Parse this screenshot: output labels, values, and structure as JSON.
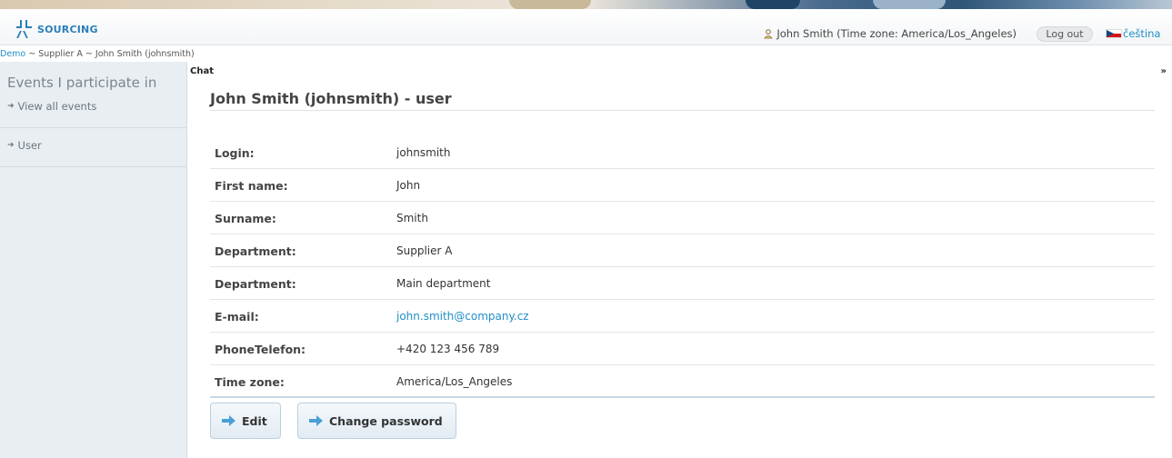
{
  "header": {
    "logo_text": "SOURCING",
    "user_text": "John Smith (Time zone: America/Los_Angeles)",
    "logout_label": "Log out",
    "language_label": "čeština"
  },
  "breadcrumb": {
    "root": "Demo",
    "rest": " ~ Supplier A ~ John Smith (johnsmith)"
  },
  "sidebar": {
    "title": "Events I participate in",
    "view_all": "View all events",
    "user": "User"
  },
  "chat": {
    "label": "Chat",
    "toggle": "»"
  },
  "main": {
    "title": "John Smith (johnsmith) - user",
    "rows": [
      {
        "label": "Login:",
        "value": "johnsmith"
      },
      {
        "label": "First name:",
        "value": "John"
      },
      {
        "label": "Surname:",
        "value": "Smith"
      },
      {
        "label": "Department:",
        "value": "Supplier A"
      },
      {
        "label": "Department:",
        "value": "Main department"
      },
      {
        "label": "E-mail:",
        "value": "john.smith@company.cz"
      },
      {
        "label": "PhoneTelefon:",
        "value": "+420 123 456 789"
      },
      {
        "label": "Time zone:",
        "value": "America/Los_Angeles"
      }
    ],
    "edit_label": "Edit",
    "change_password_label": "Change password"
  },
  "colors": {
    "accent": "#1f8fc7",
    "sidebar_bg": "#e9eef2",
    "button_arrow": "#4b9fd8"
  }
}
